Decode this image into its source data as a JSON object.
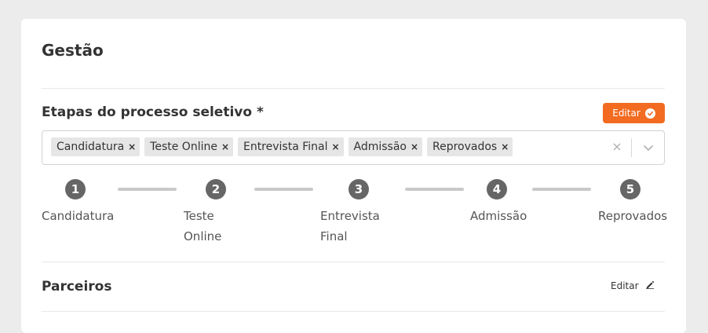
{
  "card": {
    "title": "Gestão"
  },
  "etapas": {
    "title": "Etapas do processo seletivo *",
    "edit_label": "Editar",
    "tags": [
      "Candidatura",
      "Teste Online",
      "Entrevista Final",
      "Admissão",
      "Reprovados"
    ],
    "remove_glyph": "×",
    "clear_glyph": "×"
  },
  "steps": [
    {
      "number": "1",
      "label_l1": "Candidatura",
      "label_l2": ""
    },
    {
      "number": "2",
      "label_l1": "Teste",
      "label_l2": "Online"
    },
    {
      "number": "3",
      "label_l1": "Entrevista",
      "label_l2": "Final"
    },
    {
      "number": "4",
      "label_l1": "Admissão",
      "label_l2": ""
    },
    {
      "number": "5",
      "label_l1": "Reprovados",
      "label_l2": ""
    }
  ],
  "parceiros": {
    "title": "Parceiros",
    "edit_label": "Editar"
  },
  "colors": {
    "accent": "#f26b21",
    "step": "#666666",
    "connector": "#c9c9c9"
  },
  "icons": {
    "edit_primary": "check-circle-icon",
    "dropdown": "chevron-down-icon",
    "parceiros_edit": "pencil-icon"
  }
}
